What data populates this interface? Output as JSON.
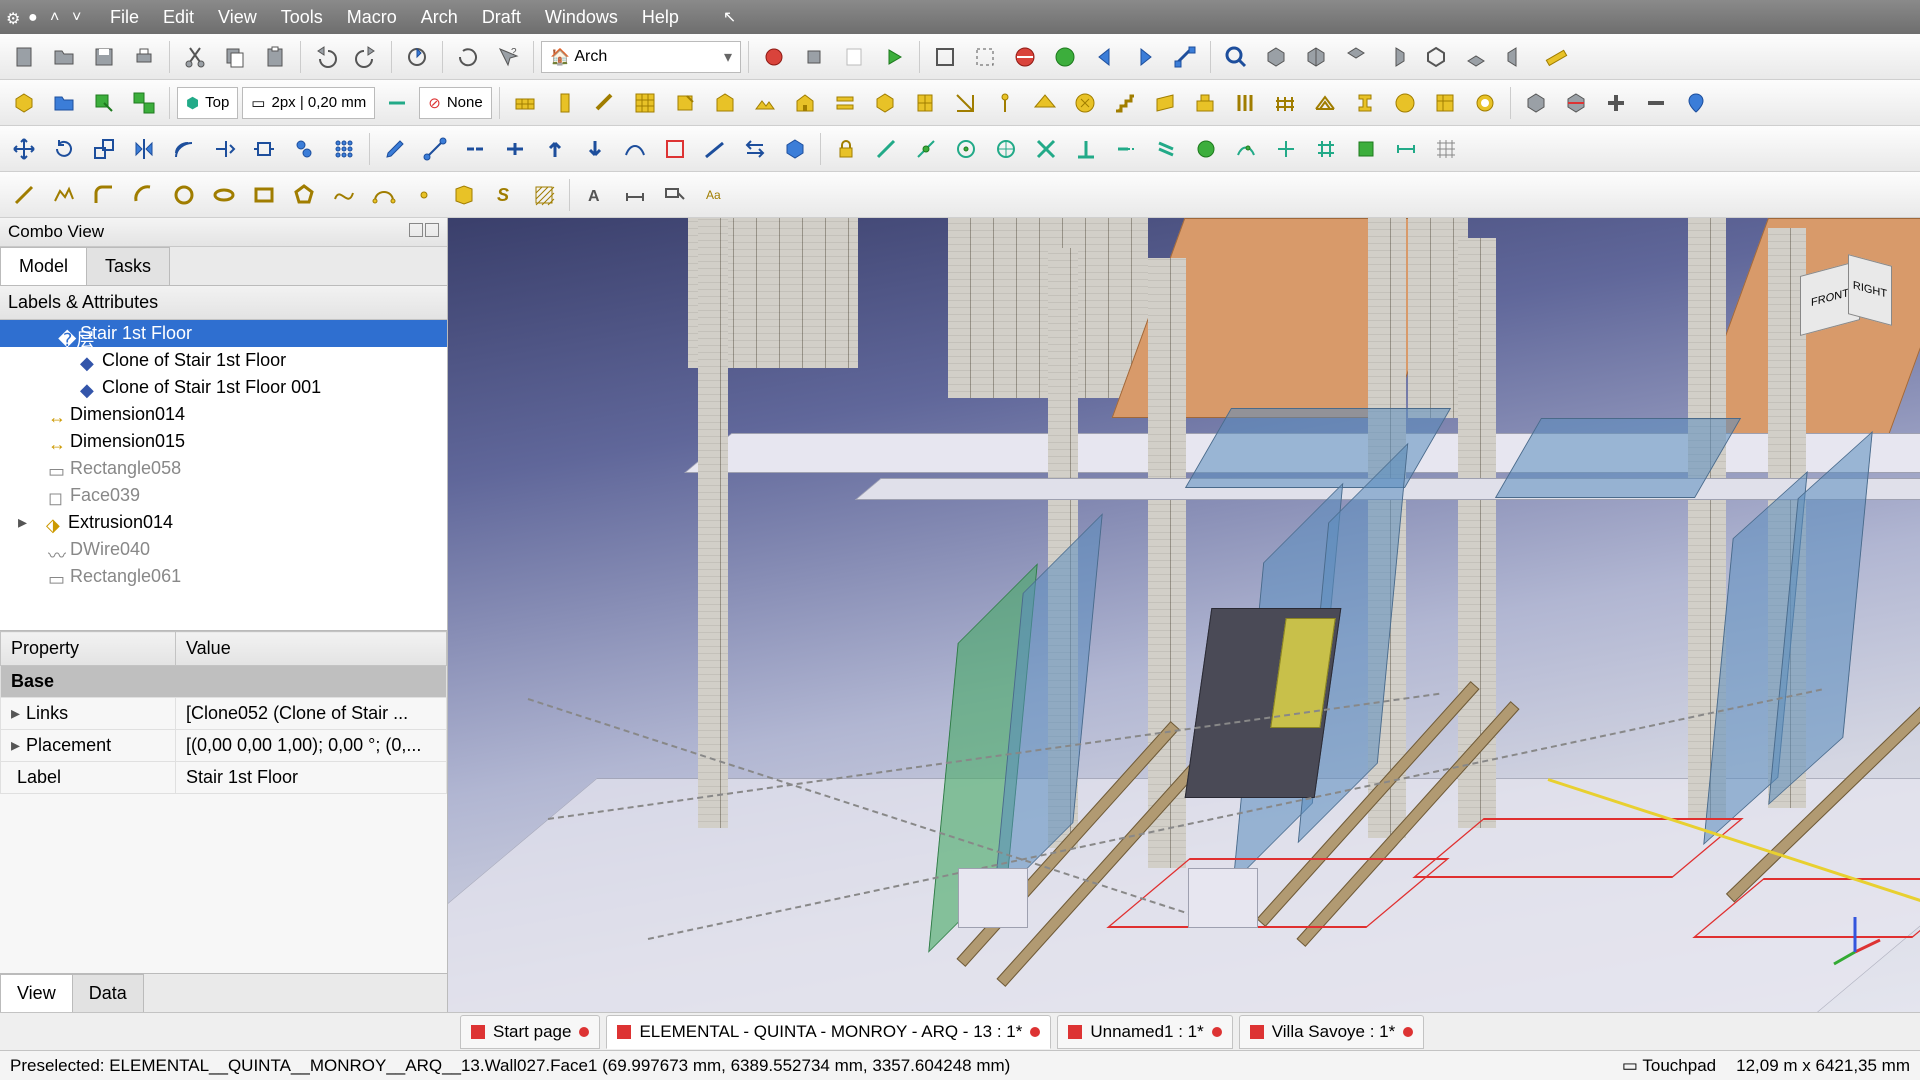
{
  "menu": [
    "File",
    "Edit",
    "View",
    "Tools",
    "Macro",
    "Arch",
    "Draft",
    "Windows",
    "Help"
  ],
  "workbench_selector": "Arch",
  "view_field": "Top",
  "lineweight_field": "2px | 0,20 mm",
  "style_field": "None",
  "combo": {
    "title": "Combo View",
    "tabs": [
      "Model",
      "Tasks"
    ],
    "active_tab": 0,
    "tree_header": "Labels & Attributes",
    "tree": [
      {
        "label": "Stair 1st Floor",
        "sel": true,
        "indent": 1,
        "exp": ""
      },
      {
        "label": "Clone of Stair 1st Floor",
        "indent": 2
      },
      {
        "label": "Clone of Stair 1st Floor 001",
        "indent": 2
      },
      {
        "label": "Dimension014",
        "indent": 1,
        "icon": "dim"
      },
      {
        "label": "Dimension015",
        "indent": 1,
        "icon": "dim"
      },
      {
        "label": "Rectangle058",
        "indent": 1,
        "dim": true
      },
      {
        "label": "Face039",
        "indent": 1,
        "dim": true
      },
      {
        "label": "Extrusion014",
        "indent": 1,
        "exp": "▸"
      },
      {
        "label": "DWire040",
        "indent": 1,
        "dim": true
      },
      {
        "label": "Rectangle061",
        "indent": 1,
        "dim": true
      }
    ],
    "prop_headers": [
      "Property",
      "Value"
    ],
    "prop_group": "Base",
    "props": [
      {
        "k": "Links",
        "v": "[Clone052 (Clone of Stair ...",
        "exp": "▸"
      },
      {
        "k": "Placement",
        "v": "[(0,00 0,00 1,00); 0,00 °; (0,...",
        "exp": "▸"
      },
      {
        "k": "Label",
        "v": "Stair 1st Floor"
      }
    ],
    "bottom_tabs": [
      "View",
      "Data"
    ],
    "bottom_active": 0
  },
  "doc_tabs": [
    {
      "label": "Start page",
      "mod": true
    },
    {
      "label": "ELEMENTAL - QUINTA - MONROY - ARQ - 13 : 1*",
      "mod": true,
      "active": true
    },
    {
      "label": "Unnamed1 : 1*",
      "mod": true
    },
    {
      "label": "Villa Savoye : 1*",
      "mod": true
    }
  ],
  "status": {
    "left": "Preselected: ELEMENTAL__QUINTA__MONROY__ARQ__13.Wall027.Face1 (69.997673 mm, 6389.552734 mm, 3357.604248 mm)",
    "nav": "Touchpad",
    "dims": "12,09 m x 6421,35 mm"
  },
  "navcube": {
    "front": "FRONT",
    "right": "RIGHT"
  },
  "icons": {
    "new": "new-file",
    "open": "open",
    "save": "save",
    "print": "print",
    "cut": "cut",
    "copy": "copy",
    "paste": "paste",
    "undo": "undo",
    "redo": "redo",
    "refresh": "refresh",
    "help": "whats-this",
    "rec": "record",
    "stop": "stop",
    "play": "play",
    "fit": "fit",
    "box": "bounding",
    "globe": "globe",
    "back": "back",
    "fwd": "fwd"
  }
}
